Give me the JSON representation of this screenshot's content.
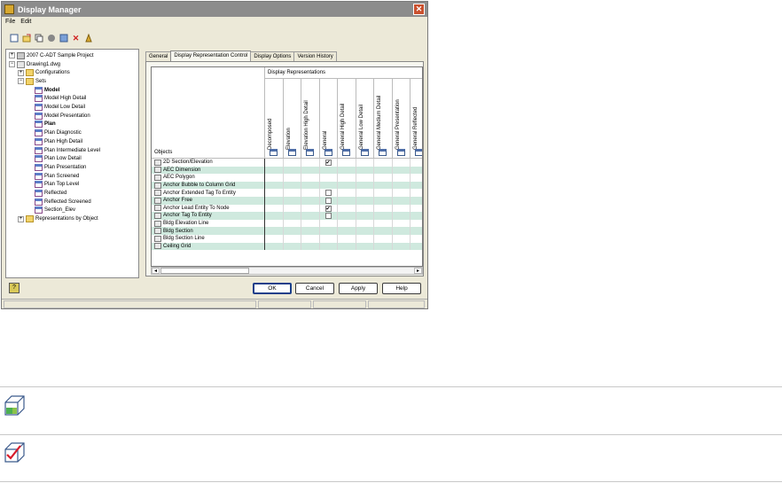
{
  "window": {
    "title": "Display Manager",
    "close_glyph": "✕"
  },
  "menu": [
    "File",
    "Edit"
  ],
  "toolbar": [
    "new-icon",
    "open-icon",
    "copy-icon",
    "paste-icon",
    "refresh-icon",
    "delete-icon",
    "purge-icon"
  ],
  "tree": [
    {
      "label": "2007 C-ADT Sample Project",
      "level": 0,
      "exp": "+",
      "icon": "proj"
    },
    {
      "label": "Drawing1.dwg",
      "level": 0,
      "exp": "−",
      "icon": "dwg"
    },
    {
      "label": "Configurations",
      "level": 1,
      "exp": "+",
      "icon": "folder"
    },
    {
      "label": "Sets",
      "level": 1,
      "exp": "−",
      "icon": "folder"
    },
    {
      "label": "Model",
      "level": 2,
      "icon": "set",
      "bold": true
    },
    {
      "label": "Model High Detail",
      "level": 2,
      "icon": "set"
    },
    {
      "label": "Model Low Detail",
      "level": 2,
      "icon": "set"
    },
    {
      "label": "Model Presentation",
      "level": 2,
      "icon": "set"
    },
    {
      "label": "Plan",
      "level": 2,
      "icon": "set",
      "bold": true
    },
    {
      "label": "Plan Diagnostic",
      "level": 2,
      "icon": "set"
    },
    {
      "label": "Plan High Detail",
      "level": 2,
      "icon": "set"
    },
    {
      "label": "Plan Intermediate Level",
      "level": 2,
      "icon": "set"
    },
    {
      "label": "Plan Low Detail",
      "level": 2,
      "icon": "set"
    },
    {
      "label": "Plan Presentation",
      "level": 2,
      "icon": "set"
    },
    {
      "label": "Plan Screened",
      "level": 2,
      "icon": "set"
    },
    {
      "label": "Plan Top Level",
      "level": 2,
      "icon": "set"
    },
    {
      "label": "Reflected",
      "level": 2,
      "icon": "set"
    },
    {
      "label": "Reflected Screened",
      "level": 2,
      "icon": "set"
    },
    {
      "label": "Section_Elev",
      "level": 2,
      "icon": "set"
    },
    {
      "label": "Representations by Object",
      "level": 1,
      "exp": "+",
      "icon": "folder"
    }
  ],
  "tabs": [
    "General",
    "Display Representation Control",
    "Display Options",
    "Version History"
  ],
  "active_tab": 1,
  "grid": {
    "objects_header": "Objects",
    "group_header": "Display Representations",
    "columns": [
      "Decomposed",
      "Elevation",
      "Elevation High Detail",
      "General",
      "General High Detail",
      "General Low Detail",
      "General Medium Detail",
      "General Presentation",
      "General Reflected"
    ],
    "rows": [
      {
        "label": "2D Section/Elevation",
        "checks": {
          "3": "checked"
        }
      },
      {
        "label": "AEC Dimension",
        "checks": {}
      },
      {
        "label": "AEC Polygon",
        "checks": {}
      },
      {
        "label": "Anchor Bubble to Column Grid",
        "checks": {}
      },
      {
        "label": "Anchor Extended Tag To Entity",
        "checks": {
          "3": "unchecked"
        }
      },
      {
        "label": "Anchor Free",
        "checks": {
          "3": "unchecked"
        }
      },
      {
        "label": "Anchor Lead Entity To Node",
        "checks": {
          "3": "checked"
        }
      },
      {
        "label": "Anchor Tag To Entity",
        "checks": {
          "3": "unchecked"
        }
      },
      {
        "label": "Bldg Elevation Line",
        "checks": {}
      },
      {
        "label": "Bldg Section",
        "checks": {}
      },
      {
        "label": "Bldg Section Line",
        "checks": {}
      },
      {
        "label": "Ceiling Grid",
        "checks": {}
      }
    ]
  },
  "buttons": {
    "ok": "OK",
    "cancel": "Cancel",
    "apply": "Apply",
    "help": "Help"
  },
  "check_glyph": "✔",
  "icons_below": [
    "display-configuration-icon",
    "display-set-icon"
  ]
}
